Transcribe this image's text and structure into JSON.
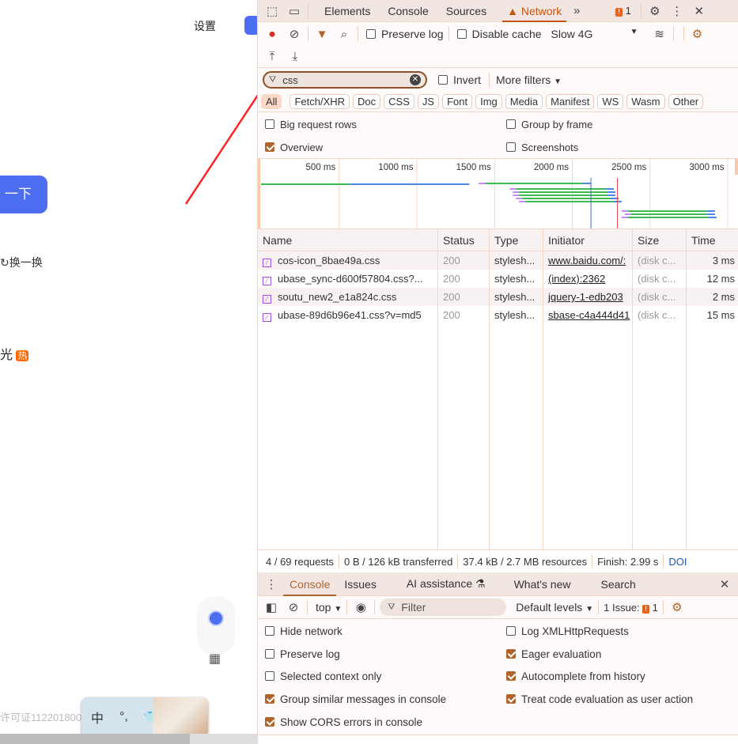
{
  "page": {
    "settings": "设置",
    "search_btn": "一下",
    "refresh": "换一换",
    "hot_text": "光",
    "hot_badge": "热",
    "footer": "许可证1122018000",
    "ime": {
      "lang": "中",
      "punct": "°,",
      "skin": "👕"
    }
  },
  "devtools": {
    "tabs": [
      {
        "label": "Elements"
      },
      {
        "label": "Console"
      },
      {
        "label": "Sources"
      },
      {
        "label": "Network",
        "active": true
      }
    ],
    "issues_count": "1",
    "toolbar": {
      "preserve_log": "Preserve log",
      "disable_cache": "Disable cache",
      "throttle": "Slow 4G"
    },
    "filter": {
      "value": "css",
      "invert": "Invert",
      "more_filters": "More filters"
    },
    "types": [
      "All",
      "Fetch/XHR",
      "Doc",
      "CSS",
      "JS",
      "Font",
      "Img",
      "Media",
      "Manifest",
      "WS",
      "Wasm",
      "Other"
    ],
    "options": {
      "big_rows": "Big request rows",
      "group_frame": "Group by frame",
      "overview": "Overview",
      "screenshots": "Screenshots"
    },
    "timeline_ticks": [
      "500 ms",
      "1000 ms",
      "1500 ms",
      "2000 ms",
      "2500 ms",
      "3000 ms"
    ],
    "columns": [
      "Name",
      "Status",
      "Type",
      "Initiator",
      "Size",
      "Time"
    ],
    "requests": [
      {
        "name": "cos-icon_8bae49a.css",
        "status": "200",
        "type": "stylesh...",
        "initiator": "www.baidu.com/:",
        "size": "(disk c...",
        "time": "3 ms"
      },
      {
        "name": "ubase_sync-d600f57804.css?...",
        "status": "200",
        "type": "stylesh...",
        "initiator": "(index):2362",
        "size": "(disk c...",
        "time": "12 ms"
      },
      {
        "name": "soutu_new2_e1a824c.css",
        "status": "200",
        "type": "stylesh...",
        "initiator": "jquery-1-edb203",
        "size": "(disk c...",
        "time": "2 ms"
      },
      {
        "name": "ubase-89d6b96e41.css?v=md5",
        "status": "200",
        "type": "stylesh...",
        "initiator": "sbase-c4a444d41",
        "size": "(disk c...",
        "time": "15 ms"
      }
    ],
    "summary": {
      "requests": "4 / 69 requests",
      "transferred": "0 B / 126 kB transferred",
      "resources": "37.4 kB / 2.7 MB resources",
      "finish": "Finish: 2.99 s",
      "dom": "DOI"
    },
    "drawer": {
      "tabs": [
        "Console",
        "Issues",
        "AI assistance",
        "What's new",
        "Search"
      ],
      "context": "top",
      "filter_placeholder": "Filter",
      "levels": "Default levels",
      "issues": "1 Issue:",
      "issues_count": "1"
    },
    "console_settings": [
      {
        "label": "Hide network",
        "checked": false
      },
      {
        "label": "Log XMLHttpRequests",
        "checked": false
      },
      {
        "label": "Preserve log",
        "checked": false
      },
      {
        "label": "Eager evaluation",
        "checked": true
      },
      {
        "label": "Selected context only",
        "checked": false
      },
      {
        "label": "Autocomplete from history",
        "checked": true
      },
      {
        "label": "Group similar messages in console",
        "checked": true
      },
      {
        "label": "Treat code evaluation as user action",
        "checked": true
      },
      {
        "label": "Show CORS errors in console",
        "checked": true
      }
    ],
    "colors": {
      "accent": "#b0642d",
      "active_tab": "#c8530a",
      "stop_red": "#d93025",
      "link_blue": "#1a56b8"
    }
  }
}
